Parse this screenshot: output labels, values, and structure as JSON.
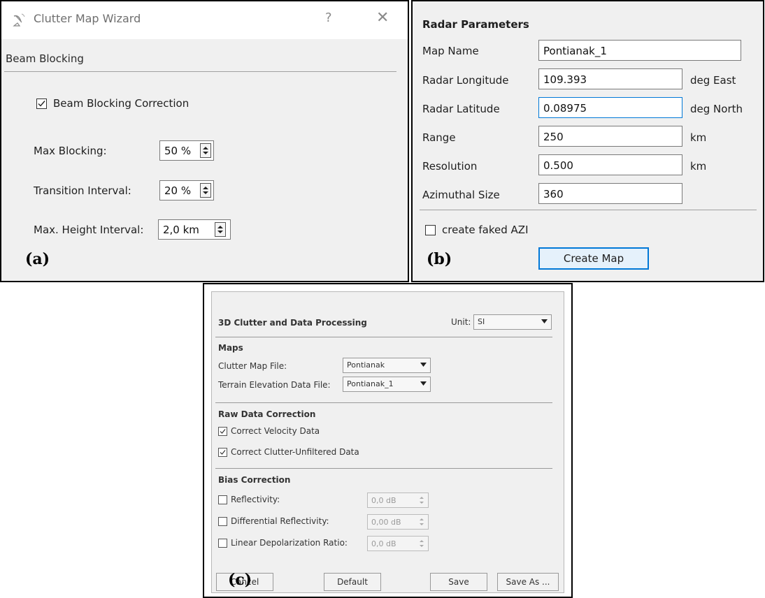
{
  "panel_a": {
    "title": "Clutter Map Wizard",
    "help": "?",
    "close": "✕",
    "section_title": "Beam Blocking",
    "beam_blocking_label": "Beam Blocking Correction",
    "beam_blocking_checked": true,
    "fields": [
      {
        "label": "Max Blocking:",
        "value": "50 %"
      },
      {
        "label": "Transition Interval:",
        "value": "20 %"
      },
      {
        "label": "Max. Height Interval:",
        "value": "2,0 km"
      }
    ],
    "tag": "(a)"
  },
  "panel_b": {
    "title": "Radar Parameters",
    "fields": [
      {
        "label": "Map Name",
        "value": "Pontianak_1",
        "unit": ""
      },
      {
        "label": "Radar Longitude",
        "value": "109.393",
        "unit": "deg East"
      },
      {
        "label": "Radar Latitude",
        "value": "0.08975",
        "unit": "deg North"
      },
      {
        "label": "Range",
        "value": "250",
        "unit": "km"
      },
      {
        "label": "Resolution",
        "value": "0.500",
        "unit": "km"
      },
      {
        "label": "Azimuthal Size",
        "value": "360",
        "unit": ""
      }
    ],
    "faked_azi_label": "create faked AZI",
    "faked_azi_checked": false,
    "create_button": "Create Map",
    "tag": "(b)",
    "accent": "#0078d7"
  },
  "panel_c": {
    "title": "3D Clutter and Data Processing",
    "unit_label": "Unit:",
    "unit_value": "SI",
    "maps_heading": "Maps",
    "clutter_map_label": "Clutter Map File:",
    "clutter_map_value": "Pontianak",
    "terrain_label": "Terrain Elevation Data File:",
    "terrain_value": "Pontianak_1",
    "raw_heading": "Raw Data Correction",
    "raw_items": [
      {
        "label": "Correct Velocity Data",
        "checked": true
      },
      {
        "label": "Correct Clutter-Unfiltered Data",
        "checked": true
      }
    ],
    "bias_heading": "Bias Correction",
    "bias_items": [
      {
        "label": "Reflectivity:",
        "value": "0,0 dB",
        "checked": false
      },
      {
        "label": "Differential Reflectivity:",
        "value": "0,00 dB",
        "checked": false
      },
      {
        "label": "Linear Depolarization Ratio:",
        "value": "0,0 dB",
        "checked": false
      }
    ],
    "buttons": {
      "cancel": "Cancel",
      "default": "Default",
      "save": "Save",
      "save_as": "Save As ..."
    },
    "tag": "(c)"
  }
}
